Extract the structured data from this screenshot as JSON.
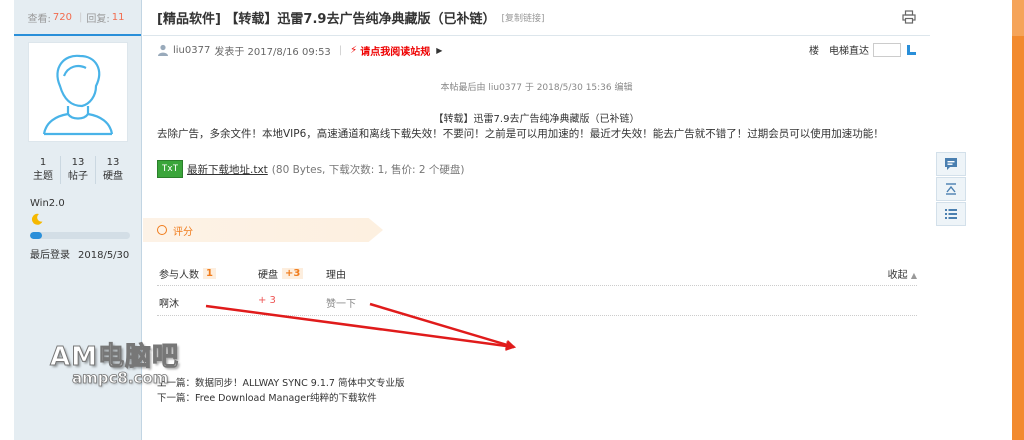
{
  "left": {
    "views_label": "查看:",
    "views": "720",
    "replies_label": "回复:",
    "replies": "11",
    "stats": [
      {
        "value": "1",
        "label": "主题"
      },
      {
        "value": "13",
        "label": "帖子"
      },
      {
        "value": "13",
        "label": "硬盘"
      }
    ],
    "os": "Win2.0",
    "level_fraction": 0.12,
    "last_login_label": "最后登录",
    "last_login": "2018/5/30"
  },
  "thread": {
    "title": "[精品软件] 【转载】迅雷7.9去广告纯净典藏版（已补链）",
    "copy_link": "[复制链接]"
  },
  "meta": {
    "author": "liu0377",
    "posted": "发表于 2017/8/16 09:53",
    "notice": "请点我阅读站规",
    "floor_label": "楼",
    "jump_label": "电梯直达"
  },
  "post": {
    "edit_note": "本帖最后由 liu0377 于 2018/5/30 15:36 编辑",
    "heading": "【转载】迅雷7.9去广告纯净典藏版（已补链）",
    "body": "去除广告，多余文件！本地VIP6，高速通道和离线下载失效！不要问！之前是可以用加速的！最近才失效！能去广告就不错了！过期会员可以使用加速功能！",
    "attachment_icon": "TxT",
    "attachment_name": "最新下载地址.txt",
    "attachment_info": "(80 Bytes, 下载次数: 1, 售价: 2 个硬盘)"
  },
  "rating": {
    "label": "评分",
    "col_people": "参与人数",
    "people_count": "1",
    "col_disk": "硬盘",
    "disk_total": "+3",
    "col_reason": "理由",
    "collapse": "收起",
    "rows": [
      {
        "user": "啊沐",
        "disk": "+ 3",
        "reason": "赞一下"
      }
    ]
  },
  "nav": {
    "prev": "上一篇：数据同步！ALLWAY SYNC 9.1.7 简体中文专业版",
    "next": "下一篇：Free Download Manager纯粹的下载软件"
  },
  "watermark": {
    "big": "AM电脑吧",
    "small": "ampc8.com"
  },
  "colors": {
    "accent_blue": "#2a8fd9",
    "orange": "#f07c1c",
    "red_notice": "#ee0000",
    "annotation_red": "#e01b1b"
  }
}
